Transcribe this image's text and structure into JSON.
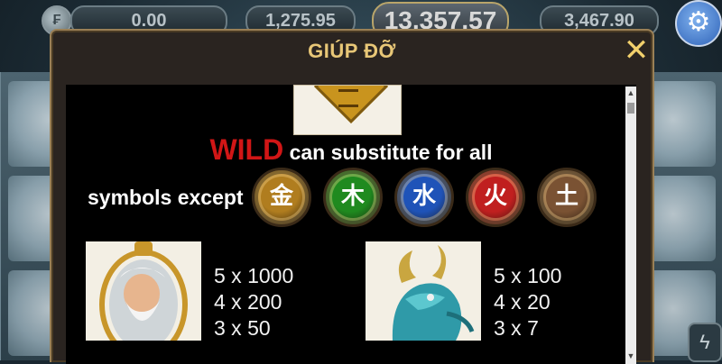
{
  "top_bar": {
    "balance": "0.00",
    "jackpot_left": "1,275.95",
    "jackpot_main": "13,357.57",
    "jackpot_right": "3,467.90",
    "coin_icon_glyph": "₣"
  },
  "dialog": {
    "title": "GIÚP ĐỠ",
    "close_glyph": "✕",
    "wild_word": "WILD",
    "wild_text": "can substitute for all",
    "except_text": "symbols except",
    "element_symbols": [
      {
        "name": "metal-element-icon",
        "glyph": "金",
        "color": "#b07d1f"
      },
      {
        "name": "wood-element-icon",
        "glyph": "木",
        "color": "#1f8a1f"
      },
      {
        "name": "water-element-icon",
        "glyph": "水",
        "color": "#1f53b8"
      },
      {
        "name": "fire-element-icon",
        "glyph": "火",
        "color": "#c01f1f"
      },
      {
        "name": "earth-element-icon",
        "glyph": "土",
        "color": "#7a5233"
      }
    ],
    "paytable": [
      {
        "symbol": "old-sage-symbol",
        "payouts": [
          "5 x 1000",
          "4 x 200",
          "3 x 50"
        ]
      },
      {
        "symbol": "azure-dragon-symbol",
        "payouts": [
          "5 x 100",
          "4 x 20",
          "3 x 7"
        ]
      }
    ]
  },
  "icons": {
    "settings": "gear-icon",
    "turbo": "lightning-icon",
    "close": "close-icon"
  }
}
